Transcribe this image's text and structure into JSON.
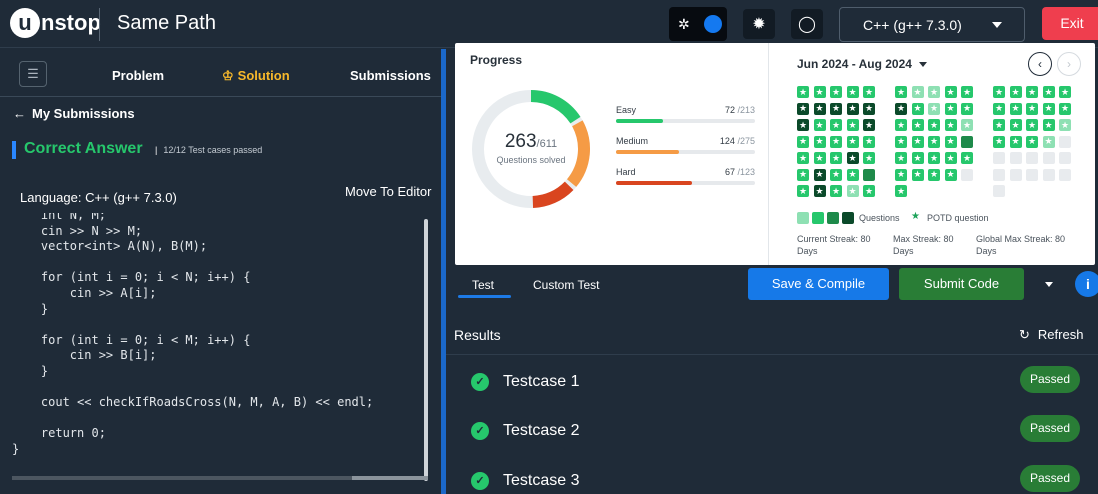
{
  "header": {
    "logo_text": "unstop",
    "title": "Same Path",
    "language": "C++ (g++ 7.3.0)",
    "exit_label": "Exit"
  },
  "left_tabs": [
    "Problem",
    "Solution",
    "Submissions"
  ],
  "back_label": "My Submissions",
  "result": {
    "status": "Correct Answer",
    "cases": "12/12 Test cases passed",
    "language": "Language: C++ (g++ 7.3.0)",
    "move_to_editor": "Move To Editor"
  },
  "code_lines": [
    "    int N, M;",
    "    cin >> N >> M;",
    "    vector<int> A(N), B(M);",
    "",
    "    for (int i = 0; i < N; i++) {",
    "        cin >> A[i];",
    "    }",
    "",
    "    for (int i = 0; i < M; i++) {",
    "        cin >> B[i];",
    "    }",
    "",
    "    cout << checkIfRoadsCross(N, M, A, B) << endl;",
    "",
    "    return 0;",
    "}"
  ],
  "progress": {
    "title": "Progress",
    "solved": "263",
    "total": "/611",
    "caption": "Questions solved",
    "difficulties": [
      {
        "name": "Easy",
        "solved": "72",
        "total": "/213",
        "color": "#26c76c",
        "fraction": 0.338
      },
      {
        "name": "Medium",
        "solved": "124",
        "total": "/275",
        "color": "#f59b45",
        "fraction": 0.451
      },
      {
        "name": "Hard",
        "solved": "67",
        "total": "/123",
        "color": "#d9451f",
        "fraction": 0.545
      }
    ]
  },
  "calendar": {
    "range": "Jun 2024 - Aug 2024",
    "legend_questions": "Questions",
    "legend_potd": "POTD question",
    "current_streak": "Current Streak: 80",
    "max_streak": "Max Streak: 80",
    "global_max_streak": "Global Max Streak: 80",
    "days_label": "Days",
    "months": [
      [
        "S",
        "S",
        "S",
        "S",
        "S",
        "D",
        "D",
        "D",
        "D",
        "D",
        "D",
        "S",
        "S",
        "S",
        "D",
        "S",
        "S",
        "S",
        "S",
        "S",
        "S",
        "S",
        "S",
        "D",
        "S",
        "S",
        "D",
        "S",
        "S",
        "M",
        "S",
        "D",
        "S",
        "L",
        "S"
      ],
      [
        "S",
        "L",
        "L",
        "S",
        "S",
        "D",
        "S",
        "L",
        "S",
        "S",
        "S",
        "S",
        "S",
        "S",
        "L",
        "S",
        "S",
        "S",
        "S",
        "M",
        "S",
        "S",
        "S",
        "S",
        "S",
        "S",
        "S",
        "S",
        "S",
        "E",
        "S"
      ],
      [
        "S",
        "S",
        "S",
        "S",
        "S",
        "S",
        "S",
        "S",
        "S",
        "S",
        "S",
        "S",
        "S",
        "S",
        "L",
        "S",
        "S",
        "S",
        "L",
        "E",
        "E",
        "E",
        "E",
        "E",
        "E",
        "E",
        "E",
        "E",
        "E",
        "E",
        "E"
      ]
    ]
  },
  "editor": {
    "tabs": [
      "Test",
      "Custom Test"
    ],
    "save_label": "Save & Compile",
    "submit_label": "Submit Code",
    "info": "i"
  },
  "results": {
    "label": "Results",
    "refresh": "Refresh",
    "testcases": [
      {
        "name": "Testcase 1",
        "status": "Passed"
      },
      {
        "name": "Testcase 2",
        "status": "Passed"
      },
      {
        "name": "Testcase 3",
        "status": "Passed"
      }
    ]
  },
  "colors": {
    "accent": "#1679e8",
    "success": "#26c76c",
    "danger": "#ef3e4e",
    "solution_tab": "#f8b92b",
    "submit": "#297d36"
  }
}
